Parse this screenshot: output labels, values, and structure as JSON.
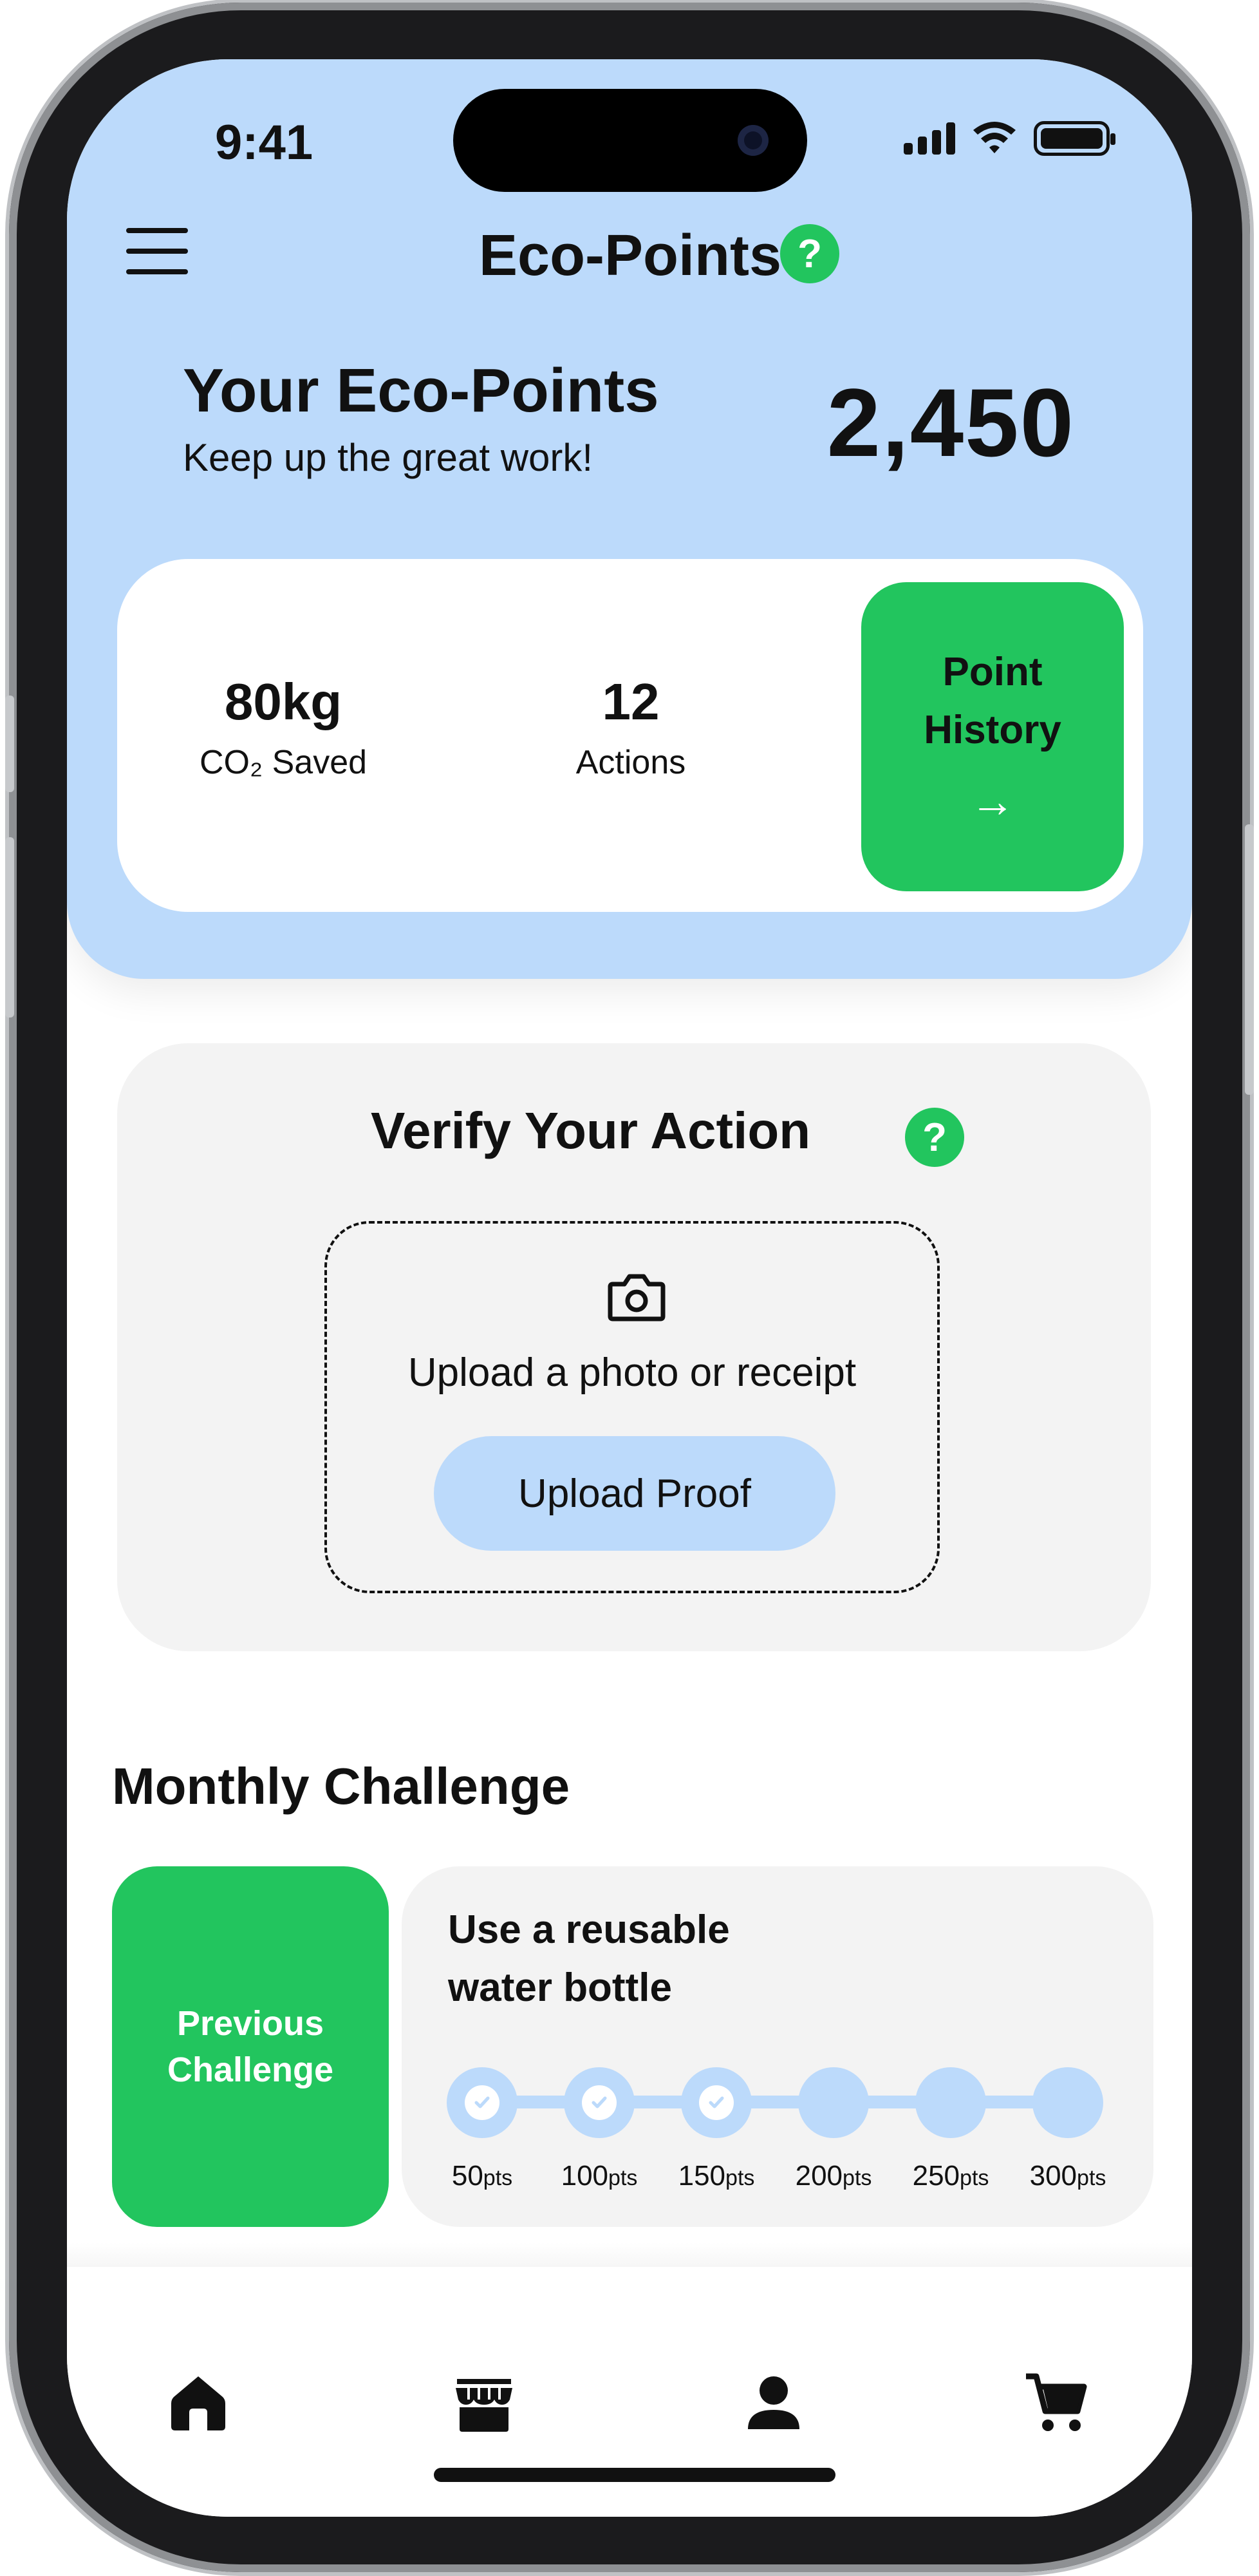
{
  "status_bar": {
    "time": "9:41"
  },
  "header": {
    "title": "Eco-Points",
    "help": "?"
  },
  "summary": {
    "heading": "Your Eco-Points",
    "subtitle": "Keep up the great work!",
    "points": "2,450"
  },
  "stats": [
    {
      "value": "80kg",
      "label": "CO₂ Saved"
    },
    {
      "value": "12",
      "label": "Actions"
    }
  ],
  "history_button": {
    "line1": "Point",
    "line2": "History",
    "arrow": "→"
  },
  "verify": {
    "title": "Verify Your Action",
    "help": "?",
    "upload_text": "Upload a photo or receipt",
    "upload_button": "Upload Proof"
  },
  "challenge": {
    "section_title": "Monthly Challenge",
    "previous_line1": "Previous",
    "previous_line2": "Challenge",
    "name_line1": "Use a reusable",
    "name_line2": "water bottle",
    "milestones": [
      {
        "points": "50",
        "unit": "pts",
        "completed": true
      },
      {
        "points": "100",
        "unit": "pts",
        "completed": true
      },
      {
        "points": "150",
        "unit": "pts",
        "completed": true
      },
      {
        "points": "200",
        "unit": "pts",
        "completed": false
      },
      {
        "points": "250",
        "unit": "pts",
        "completed": false
      },
      {
        "points": "300",
        "unit": "pts",
        "completed": false
      }
    ]
  },
  "nav": [
    "home-icon",
    "store-icon",
    "profile-icon",
    "cart-icon"
  ],
  "colors": {
    "accent_green": "#22c55e",
    "light_blue": "#bcdafb",
    "card_gray": "#f3f3f3"
  }
}
